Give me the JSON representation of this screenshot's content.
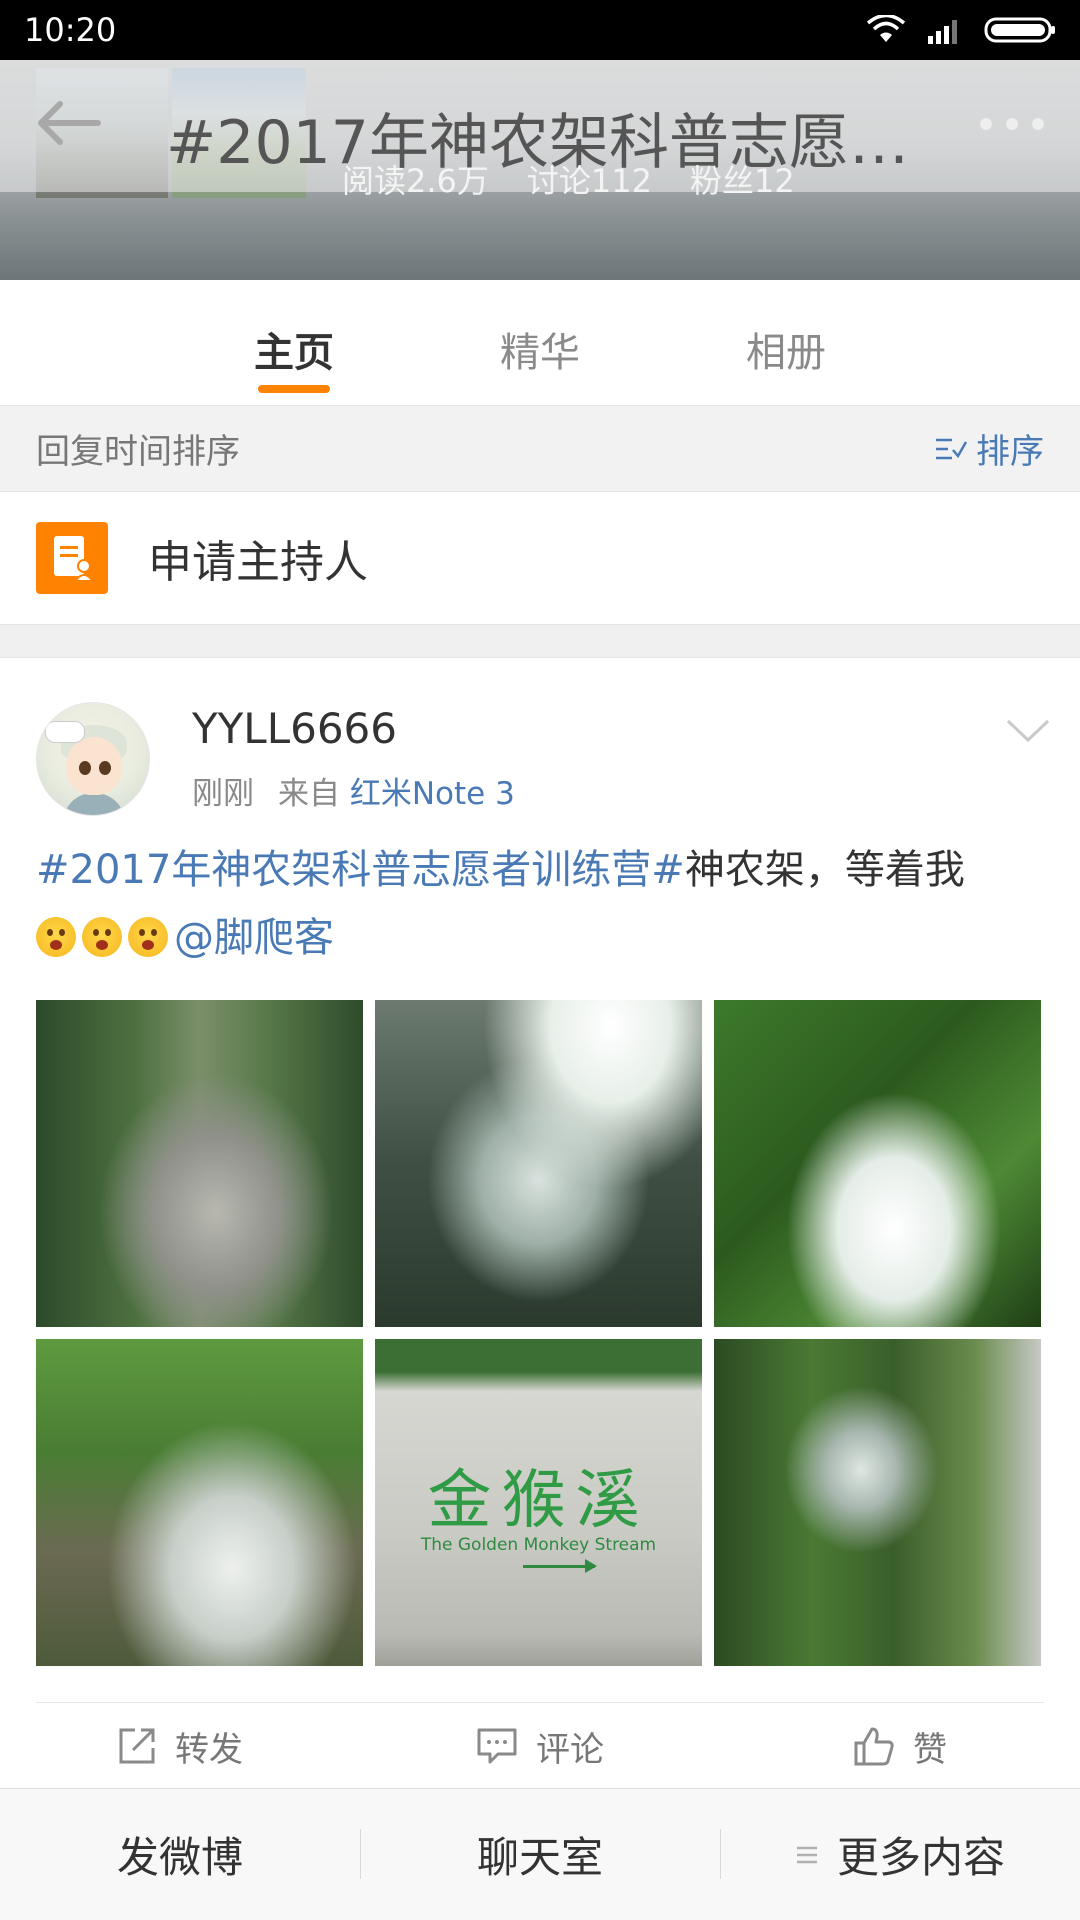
{
  "status_bar": {
    "time": "10:20"
  },
  "header": {
    "title": "#2017年神农架科普志愿者...",
    "stats": [
      "阅读2.6万",
      "讨论112",
      "粉丝12"
    ]
  },
  "tabs": [
    {
      "label": "主页",
      "active": true
    },
    {
      "label": "精华",
      "active": false
    },
    {
      "label": "相册",
      "active": false
    }
  ],
  "sort_bar": {
    "label": "回复时间排序",
    "button": "排序"
  },
  "apply_host": {
    "label": "申请主持人"
  },
  "post": {
    "username": "YYLL6666",
    "time": "刚刚",
    "source_prefix": "来自",
    "source": "红米Note 3",
    "topic": "#2017年神农架科普志愿者训练营#",
    "text": "神农架，等着我",
    "mention": "@脚爬客",
    "emoji_count": 3,
    "photo_stone_text": "金猴溪",
    "photo_stone_subtext": "The Golden Monkey Stream",
    "actions": [
      "转发",
      "评论",
      "赞"
    ]
  },
  "bottom_bar": [
    "发微博",
    "聊天室",
    "更多内容"
  ],
  "colors": {
    "accent": "#ff8200",
    "link": "#4a7ab5"
  }
}
